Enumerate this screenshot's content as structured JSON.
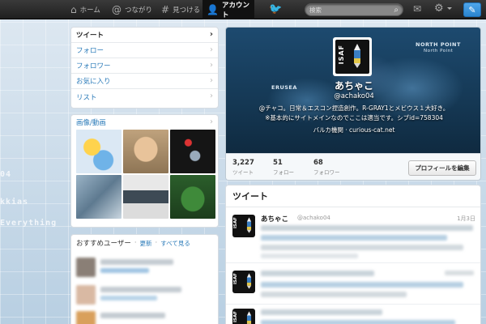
{
  "nav": {
    "home": {
      "label": "ホーム",
      "icon": "home-icon"
    },
    "connect": {
      "label": "つながり",
      "icon": "at-icon"
    },
    "discover": {
      "label": "見つける",
      "icon": "hash-icon"
    },
    "account": {
      "label": "アカウント",
      "icon": "person-icon"
    },
    "search_placeholder": "検索"
  },
  "sidebar": {
    "items": [
      {
        "label": "ツイート",
        "active": true
      },
      {
        "label": "フォロー",
        "active": false
      },
      {
        "label": "フォロワー",
        "active": false
      },
      {
        "label": "お気に入り",
        "active": false
      },
      {
        "label": "リスト",
        "active": false
      }
    ]
  },
  "media": {
    "title": "画像/動画"
  },
  "suggestions": {
    "title": "おすすめユーザー",
    "refresh": "更新",
    "view_all": "すべて見る"
  },
  "profile": {
    "name": "あちゃこ",
    "handle": "@achako04",
    "bio_line1": "@チャコ。日常＆エスコン捏造創作。R-GRAY1とメビウス１大好き。",
    "bio_line2": "※基本的にサイトメインなのでここは適当です。シブid=758304",
    "location": "バルカ機関 · curious-cat.net",
    "avatar_text": "ISAF",
    "map_labels": {
      "north": "NORTH POINT",
      "north_sub": "North Point",
      "erusea": "ERUSEA"
    }
  },
  "stats": {
    "tweets": {
      "count": "3,227",
      "label": "ツイート"
    },
    "following": {
      "count": "51",
      "label": "フォロー"
    },
    "followers": {
      "count": "68",
      "label": "フォロワー"
    },
    "edit_label": "プロフィールを編集"
  },
  "tweets_panel": {
    "title": "ツイート",
    "first": {
      "name": "あちゃこ",
      "handle": "@achako04",
      "date": "1月3日"
    }
  },
  "background": {
    "text1": "04",
    "text2": "kkias",
    "text3": "Everything"
  },
  "colors": {
    "link": "#2b7bb9",
    "accent": "#2a84cf",
    "topbar": "#222222"
  }
}
